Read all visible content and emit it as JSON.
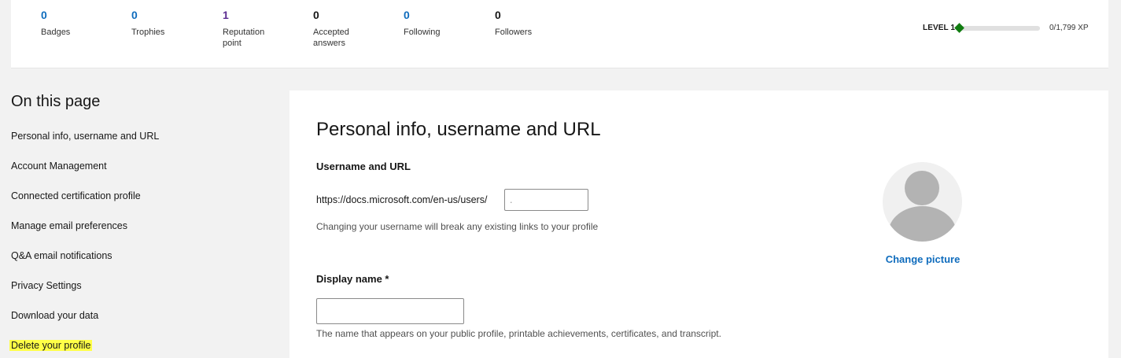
{
  "stats": [
    {
      "value": "0",
      "label": "Badges",
      "color": "#0f6cbd"
    },
    {
      "value": "0",
      "label": "Trophies",
      "color": "#0f6cbd"
    },
    {
      "value": "1",
      "label": "Reputation point",
      "color": "#5c2d91"
    },
    {
      "value": "0",
      "label": "Accepted answers",
      "color": "#171717"
    },
    {
      "value": "0",
      "label": "Following",
      "color": "#0f6cbd"
    },
    {
      "value": "0",
      "label": "Followers",
      "color": "#171717"
    }
  ],
  "level": {
    "label": "LEVEL 1",
    "xp": "0/1,799 XP",
    "progress_fraction": 0,
    "color": "#107c10"
  },
  "toc": {
    "title": "On this page",
    "items": [
      "Personal info, username and URL",
      "Account Management",
      "Connected certification profile",
      "Manage email preferences",
      "Q&A email notifications",
      "Privacy Settings",
      "Download your data",
      "Delete your profile"
    ],
    "highlight_color": "#ffff47"
  },
  "main": {
    "title": "Personal info, username and URL",
    "username_section": {
      "label": "Username and URL",
      "url_prefix": "https://docs.microsoft.com/en-us/users/",
      "input_value": ". ",
      "help": "Changing your username will break any existing links to your profile"
    },
    "display_name_section": {
      "label": "Display name *",
      "input_value": "",
      "help": "The name that appears on your public profile, printable achievements, certificates, and transcript."
    },
    "avatar": {
      "icon": "default-avatar-icon",
      "change_label": "Change picture"
    }
  },
  "colors": {
    "accent": "#0f6cbd",
    "background": "#f2f2f2"
  }
}
